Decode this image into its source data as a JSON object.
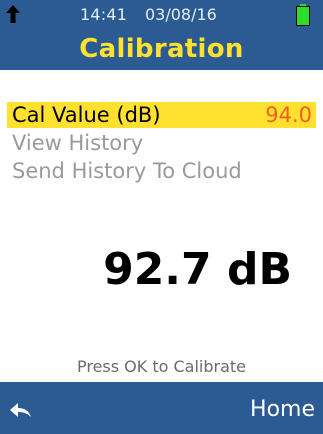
{
  "status": {
    "time": "14:41",
    "date": "03/08/16",
    "up_arrow_icon": "up-arrow-icon",
    "battery_icon": "battery-full-icon"
  },
  "header": {
    "title": "Calibration"
  },
  "menu": {
    "items": [
      {
        "label": "Cal Value (dB)",
        "value": "94.0",
        "selected": true
      },
      {
        "label": "View History",
        "selected": false
      },
      {
        "label": "Send History To Cloud",
        "selected": false
      }
    ]
  },
  "reading": {
    "value_text": "92.7 dB"
  },
  "hint": "Press OK to Calibrate",
  "footer": {
    "back_icon": "back-arrow-icon",
    "home_label": "Home"
  },
  "colors": {
    "header_bg": "#2b5b92",
    "accent_yellow": "#ffe12e",
    "value_orange": "#f06020",
    "battery_green": "#2bdc2b"
  }
}
